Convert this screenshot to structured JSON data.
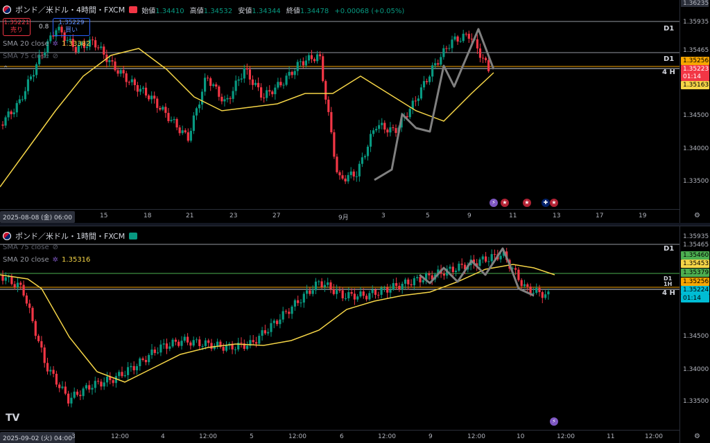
{
  "top_pane": {
    "symbol": "ポンド／米ドル・4時間・FXCM",
    "ohlc": {
      "open_label": "始値",
      "open": "1.34410",
      "high_label": "高値",
      "high": "1.34532",
      "low_label": "安値",
      "low": "1.34344",
      "close_label": "終値",
      "close": "1.34478",
      "change": "+0.00068 (+0.05%)"
    },
    "sell": {
      "price": "1.35221",
      "label": "売り"
    },
    "buy": {
      "price": "1.35229",
      "label": "買い"
    },
    "spread": "0.8",
    "indicators": [
      {
        "name": "SMA 20 close",
        "value": "1.33382"
      },
      {
        "name": "SMA 75 close",
        "value": ""
      }
    ],
    "price_labels": [
      "1.36235",
      "1.35935",
      "1.35465",
      "1.34500",
      "1.34000",
      "1.33500"
    ],
    "tags": [
      {
        "text": "1.35256",
        "color": "#f7a600"
      },
      {
        "text": "1.35223",
        "color": "#f23645"
      },
      {
        "text": "01:14",
        "color": "#f23645"
      },
      {
        "text": "1.35163",
        "color": "#f5d547"
      }
    ],
    "tf_labels": [
      "D1",
      "D1",
      "4 H"
    ],
    "x_labels": [
      "15",
      "18",
      "21",
      "23",
      "27",
      "9月",
      "3",
      "5",
      "9",
      "11",
      "13",
      "17",
      "19"
    ],
    "x_selected": "2025-08-08 (金)  06:00"
  },
  "bottom_pane": {
    "symbol": "ポンド／米ドル・1時間・FXCM",
    "indicators": [
      {
        "name": "SMA 75 close",
        "value": ""
      },
      {
        "name": "SMA 20 close",
        "value": "1.35316"
      }
    ],
    "price_labels": [
      "1.35935",
      "1.35465",
      "1.34500",
      "1.34000",
      "1.33500"
    ],
    "tags": [
      {
        "text": "1.35460",
        "color": "#4caf50"
      },
      {
        "text": "1.35453",
        "color": "#f5d547"
      },
      {
        "text": "1.35379",
        "color": "#4caf50"
      },
      {
        "text": "1.35256",
        "color": "#f7a600"
      },
      {
        "text": "1.35224",
        "color": "#00bcd4"
      },
      {
        "text": "01:14",
        "color": "#00bcd4"
      }
    ],
    "tf_labels": [
      "D1",
      "D1",
      "1H",
      "4 H"
    ],
    "x_labels": [
      "3",
      "12:00",
      "4",
      "12:00",
      "5",
      "12:00",
      "6",
      "12:00",
      "9",
      "12:00",
      "10",
      "12:00",
      "11",
      "12:00"
    ],
    "x_selected": "2025-09-02 (火)  04:00"
  },
  "brand": "TV",
  "colors": {
    "up": "#089981",
    "down": "#f23645",
    "sma20": "#f5d547",
    "sma75": "#808080",
    "level_orange": "#f7a600"
  }
}
